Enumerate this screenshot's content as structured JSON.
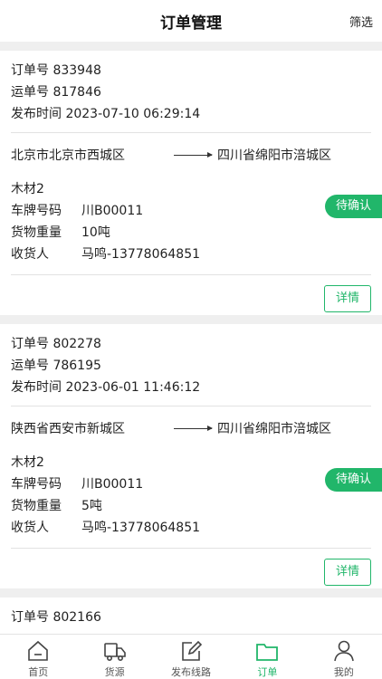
{
  "header": {
    "title": "订单管理",
    "filter_label": "筛选"
  },
  "orders": [
    {
      "order_label": "订单号",
      "order_no": "833948",
      "waybill_label": "运单号",
      "waybill_no": "817846",
      "time_label": "发布时间",
      "time": "2023-07-10 06:29:14",
      "from": "北京市北京市西城区",
      "to": "四川省绵阳市涪城区",
      "goods": "木材2",
      "plate_label": "车牌号码",
      "plate": "川B00011",
      "weight_label": "货物重量",
      "weight": "10吨",
      "receiver_label": "收货人",
      "receiver": "马鸣-13778064851",
      "status": "待确认",
      "detail_label": "详情"
    },
    {
      "order_label": "订单号",
      "order_no": "802278",
      "waybill_label": "运单号",
      "waybill_no": "786195",
      "time_label": "发布时间",
      "time": "2023-06-01 11:46:12",
      "from": "陕西省西安市新城区",
      "to": "四川省绵阳市涪城区",
      "goods": "木材2",
      "plate_label": "车牌号码",
      "plate": "川B00011",
      "weight_label": "货物重量",
      "weight": "5吨",
      "receiver_label": "收货人",
      "receiver": "马鸣-13778064851",
      "status": "待确认",
      "detail_label": "详情"
    },
    {
      "order_label": "订单号",
      "order_no": "802166"
    }
  ],
  "tabs": [
    {
      "label": "首页",
      "icon": "home-icon"
    },
    {
      "label": "货源",
      "icon": "truck-icon"
    },
    {
      "label": "发布线路",
      "icon": "edit-icon"
    },
    {
      "label": "订单",
      "icon": "folder-icon",
      "active": true
    },
    {
      "label": "我的",
      "icon": "user-icon"
    }
  ],
  "colors": {
    "accent": "#21b66a",
    "background": "#efefef"
  }
}
